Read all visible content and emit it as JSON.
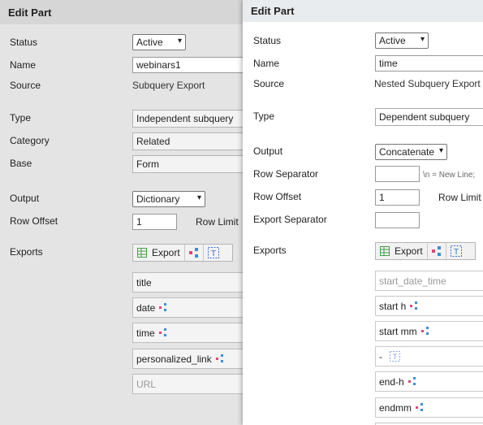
{
  "back": {
    "title": "Edit Part",
    "status": {
      "label": "Status",
      "value": "Active"
    },
    "name": {
      "label": "Name",
      "value": "webinars1"
    },
    "source": {
      "label": "Source",
      "value": "Subquery Export"
    },
    "type": {
      "label": "Type",
      "value": "Independent subquery"
    },
    "category": {
      "label": "Category",
      "value": "Related"
    },
    "base": {
      "label": "Base",
      "value": "Form"
    },
    "output": {
      "label": "Output",
      "value": "Dictionary"
    },
    "row_offset": {
      "label": "Row Offset",
      "value": "1"
    },
    "row_limit_label": "Row Limit",
    "exports_label": "Exports",
    "export_button": "Export",
    "items": [
      "title",
      "date",
      "time",
      "personalized_link",
      "URL"
    ]
  },
  "front": {
    "title": "Edit Part",
    "status": {
      "label": "Status",
      "value": "Active"
    },
    "name": {
      "label": "Name",
      "value": "time"
    },
    "source": {
      "label": "Source",
      "value": "Nested Subquery Export /"
    },
    "type": {
      "label": "Type",
      "value": "Dependent subquery"
    },
    "output": {
      "label": "Output",
      "value": "Concatenate"
    },
    "row_separator": {
      "label": "Row Separator",
      "value": "",
      "hint": "\\n = New Line;"
    },
    "row_offset": {
      "label": "Row Offset",
      "value": "1"
    },
    "row_limit_label": "Row Limit",
    "export_separator": {
      "label": "Export Separator",
      "value": ""
    },
    "exports_label": "Exports",
    "export_button": "Export",
    "items": [
      "start_date_time",
      "start h",
      "start mm",
      "-",
      "end-h",
      "endmm"
    ]
  },
  "icons": {
    "table": "table-icon",
    "link": "link-icon",
    "text": "text-icon",
    "chevron": "chevron-down-icon"
  },
  "colors": {
    "link_pink": "#e0457b",
    "link_blue": "#3a8fd8",
    "text_icon": "#3b6fd1",
    "table_icon": "#4a9a4a"
  }
}
